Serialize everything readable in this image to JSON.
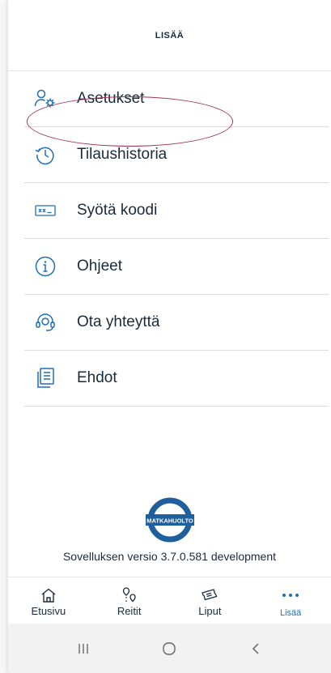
{
  "header": {
    "title": "LISÄÄ"
  },
  "menu": {
    "items": [
      {
        "label": "Asetukset",
        "icon": "user-settings-icon"
      },
      {
        "label": "Tilaushistoria",
        "icon": "history-icon"
      },
      {
        "label": "Syötä koodi",
        "icon": "code-input-icon"
      },
      {
        "label": "Ohjeet",
        "icon": "info-icon"
      },
      {
        "label": "Ota yhteyttä",
        "icon": "headset-icon"
      },
      {
        "label": "Ehdot",
        "icon": "documents-icon"
      }
    ]
  },
  "logo": {
    "text": "MATKAHUOLTO"
  },
  "version": "Sovelluksen versio 3.7.0.581  development",
  "tabbar": {
    "tabs": [
      {
        "label": "Etusivu",
        "icon": "home-icon"
      },
      {
        "label": "Reitit",
        "icon": "route-icon"
      },
      {
        "label": "Liput",
        "icon": "ticket-icon"
      },
      {
        "label": "Lisää",
        "icon": "more-dots-icon",
        "active": true
      }
    ]
  },
  "colors": {
    "accent": "#1e6fb3",
    "highlight": "#a0325a",
    "brand_blue": "#1f5f9e",
    "text": "#1b2a3a"
  }
}
